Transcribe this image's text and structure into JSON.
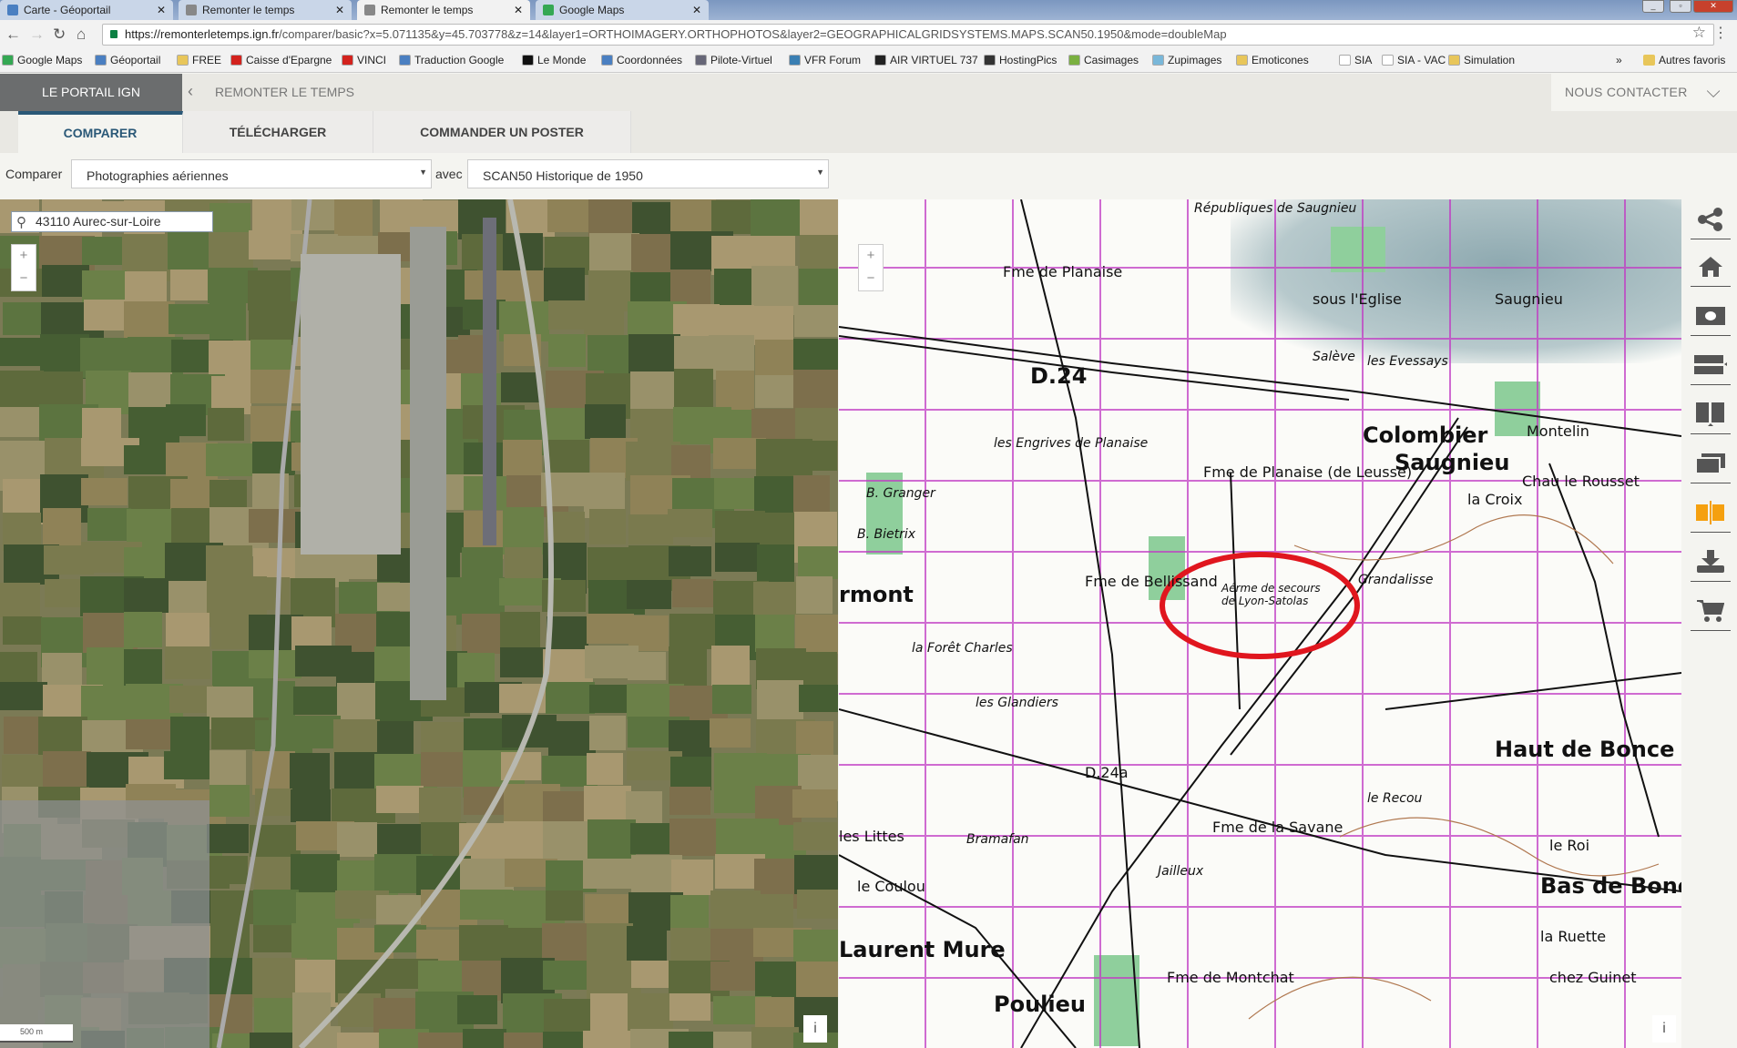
{
  "browser": {
    "tabs": [
      {
        "label": "Carte - Géoportail",
        "active": false
      },
      {
        "label": "Remonter le temps",
        "active": false
      },
      {
        "label": "Remonter le temps",
        "active": true
      },
      {
        "label": "Google Maps",
        "active": false
      }
    ],
    "url_host": "https://remonterletemps.ign.fr",
    "url_path": "/comparer/basic?x=5.071135&y=45.703778&z=14&layer1=ORTHOIMAGERY.ORTHOPHOTOS&layer2=GEOGRAPHICALGRIDSYSTEMS.MAPS.SCAN50.1950&mode=doubleMap",
    "bookmarks": [
      "Google Maps",
      "Géoportail",
      "FREE",
      "Caisse d'Epargne",
      "VINCI",
      "Traduction Google",
      "Le Monde",
      "Coordonnées",
      "Pilote-Virtuel",
      "VFR Forum",
      "AIR VIRTUEL 737",
      "HostingPics",
      "Casimages",
      "Zupimages",
      "Emoticones",
      "SIA",
      "SIA - VAC",
      "Simulation"
    ],
    "more_bookmarks": "»",
    "other_bookmarks": "Autres favoris"
  },
  "header": {
    "portal": "LE PORTAIL IGN",
    "section": "REMONTER LE TEMPS",
    "contact": "NOUS CONTACTER"
  },
  "tabs": [
    "COMPARER",
    "TÉLÉCHARGER",
    "COMMANDER UN POSTER"
  ],
  "compare": {
    "label": "Comparer",
    "layer1": "Photographies aériennes",
    "with_label": "avec",
    "layer2": "SCAN50 Historique de 1950"
  },
  "left_map": {
    "search_value": "43110 Aurec-sur-Loire",
    "zoom_in": "+",
    "zoom_out": "−",
    "scale": "500 m",
    "info": "i"
  },
  "right_map": {
    "zoom_in": "+",
    "zoom_out": "−",
    "info": "i",
    "annotation_color": "#e0161e",
    "labels": {
      "colombier": "Colombier",
      "saugnieu": "Saugnieu",
      "saugnieu_n": "Saugnieu",
      "sous_eglise": "sous l'Eglise",
      "republiques": "Républiques de Saugnieu",
      "planaise": "Fme de Planaise",
      "fme_planaise": "Fme de Planaise (de Leusse)",
      "engrives": "les Engrives de Planaise",
      "d24": "D.24",
      "bellissand": "Fme de Bellissand",
      "aerodrome": "Aérme de secours de Lyon-Satolas",
      "montelin": "Montelin",
      "rousset": "Chau le Rousset",
      "la_croix": "la Croix",
      "grandalisse": "Grandalisse",
      "haut_bonce": "Haut de Bonce",
      "bas_bonce": "Bas de Bonce",
      "savane": "Fme de la Savane",
      "montchat": "Fme de Montchat",
      "poulieu": "Poulieu",
      "chez_guinet": "chez Guinet",
      "jailleux": "Jailleux",
      "bramafan": "Bramafan",
      "glandiers": "les Glandiers",
      "foret": "la Forêt Charles",
      "coulou": "le Coulou",
      "laurent": "Laurent Mure",
      "ruette": "la Ruette",
      "le_roi": "le Roi",
      "recou": "le Recou",
      "b_granger": "B. Granger",
      "b_bietrix": "B. Bietrix",
      "les_evessays": "les Evessays",
      "saleve": "Salève",
      "les_littes": "les Littes",
      "rmont": "rmont",
      "d24a": "D.24a"
    }
  },
  "sidebar": [
    "share-icon",
    "home-icon",
    "camera-icon",
    "horizontal-split-icon",
    "vertical-split-icon",
    "layers-icon",
    "compare-split-icon",
    "download-icon",
    "cart-icon"
  ],
  "colors": {
    "accent": "#2a5877",
    "active_tool": "#f5a00f",
    "grid": "#c13bc4"
  }
}
